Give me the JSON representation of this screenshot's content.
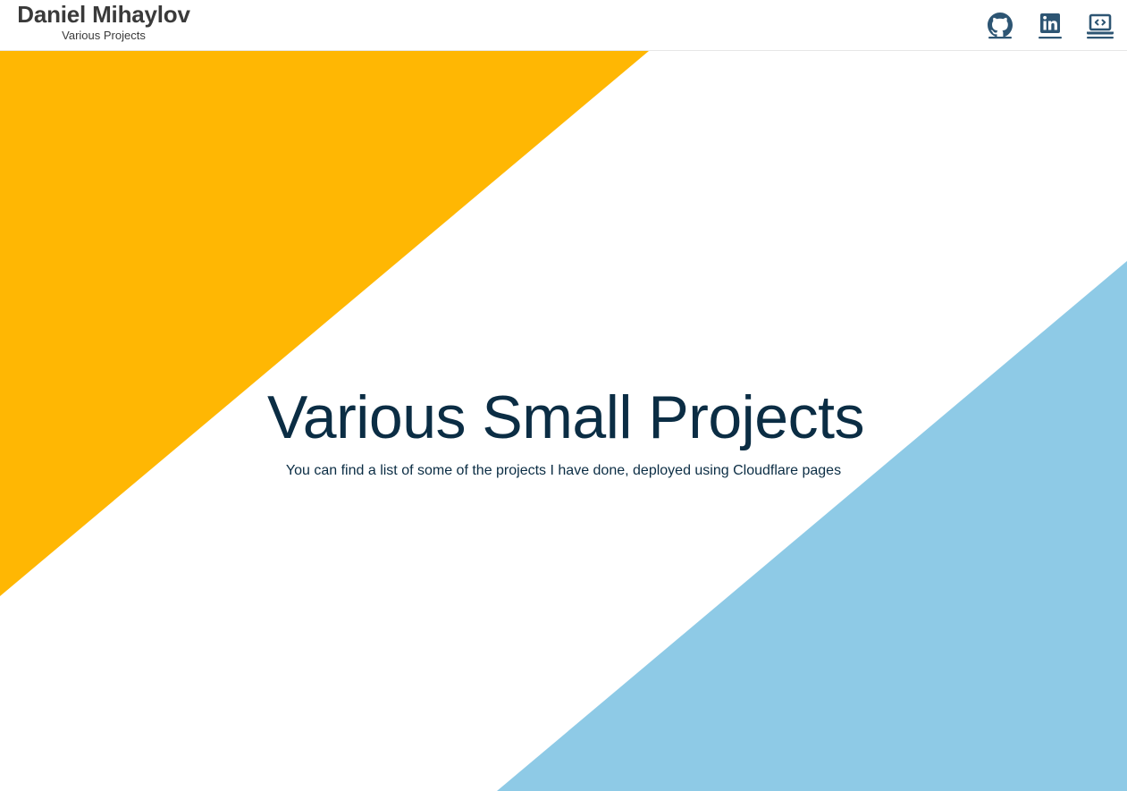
{
  "header": {
    "name": "Daniel Mihaylov",
    "subtitle": "Various Projects",
    "links": [
      {
        "name": "github",
        "icon": "github-icon"
      },
      {
        "name": "linkedin",
        "icon": "linkedin-icon"
      },
      {
        "name": "portfolio",
        "icon": "laptop-code-icon"
      }
    ]
  },
  "hero": {
    "title": "Various Small Projects",
    "subtitle": "You can find a list of some of the projects I have done, deployed using Cloudflare pages"
  },
  "colors": {
    "accent_yellow": "#ffb703",
    "accent_blue": "#8ecae6",
    "text_dark": "#0b2d44",
    "icon": "#2d5573"
  }
}
